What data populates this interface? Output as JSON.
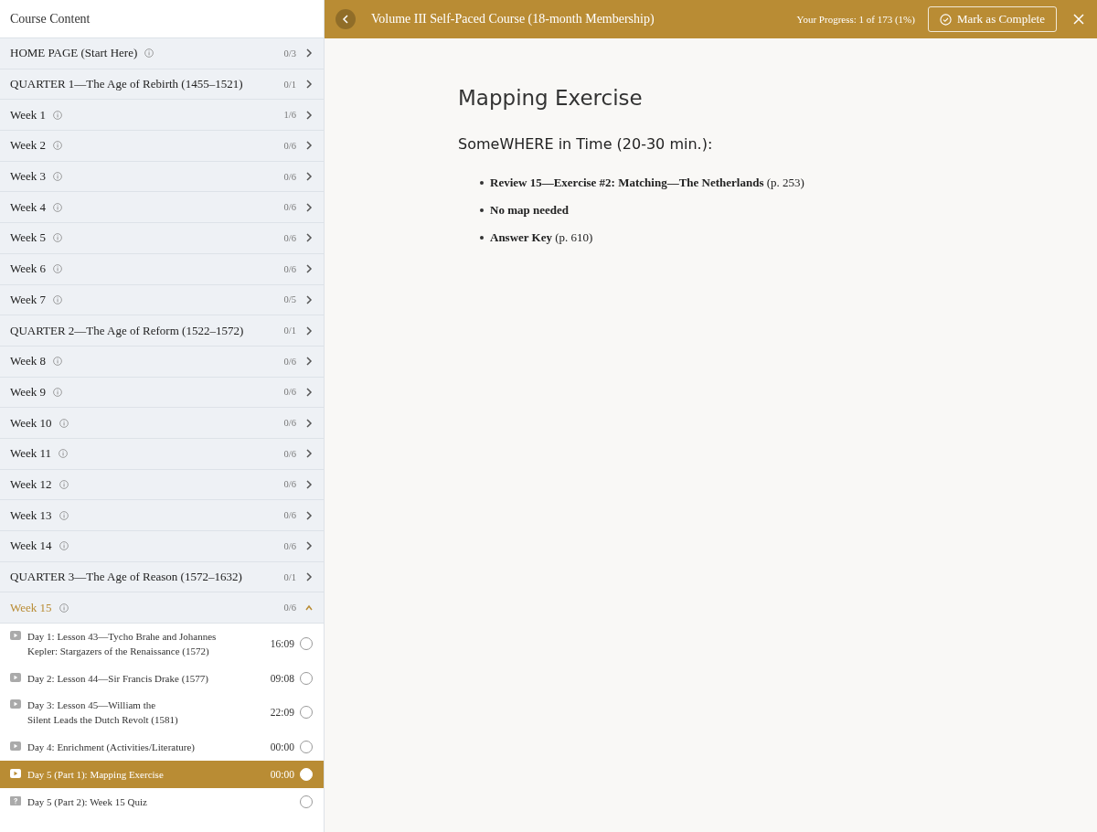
{
  "sidebar": {
    "title": "Course Content",
    "sections": [
      {
        "title": "HOME PAGE (Start Here)",
        "info": true,
        "progress": "0/3",
        "expanded": false
      },
      {
        "title": "QUARTER 1—The Age of Rebirth (1455–1521)",
        "info": false,
        "progress": "0/1",
        "expanded": false
      },
      {
        "title": "Week 1",
        "info": true,
        "progress": "1/6",
        "expanded": false
      },
      {
        "title": "Week 2",
        "info": true,
        "progress": "0/6",
        "expanded": false
      },
      {
        "title": "Week 3",
        "info": true,
        "progress": "0/6",
        "expanded": false
      },
      {
        "title": "Week 4",
        "info": true,
        "progress": "0/6",
        "expanded": false
      },
      {
        "title": "Week 5",
        "info": true,
        "progress": "0/6",
        "expanded": false
      },
      {
        "title": "Week 6",
        "info": true,
        "progress": "0/6",
        "expanded": false
      },
      {
        "title": "Week 7",
        "info": true,
        "progress": "0/5",
        "expanded": false
      },
      {
        "title": "QUARTER 2—The Age of Reform (1522–1572)",
        "info": false,
        "progress": "0/1",
        "expanded": false
      },
      {
        "title": "Week 8",
        "info": true,
        "progress": "0/6",
        "expanded": false
      },
      {
        "title": "Week 9",
        "info": true,
        "progress": "0/6",
        "expanded": false
      },
      {
        "title": "Week 10",
        "info": true,
        "progress": "0/6",
        "expanded": false
      },
      {
        "title": "Week 11",
        "info": true,
        "progress": "0/6",
        "expanded": false
      },
      {
        "title": "Week 12",
        "info": true,
        "progress": "0/6",
        "expanded": false
      },
      {
        "title": "Week 13",
        "info": true,
        "progress": "0/6",
        "expanded": false
      },
      {
        "title": "Week 14",
        "info": true,
        "progress": "0/6",
        "expanded": false
      },
      {
        "title": "QUARTER 3—The Age of Reason (1572–1632)",
        "info": false,
        "progress": "0/1",
        "expanded": false
      },
      {
        "title": "Week 15",
        "info": true,
        "progress": "0/6",
        "expanded": true,
        "lessons": [
          {
            "kind": "video",
            "lines": [
              "Day 1: Lesson 43—Tycho Brahe and Johannes",
              "Kepler: Stargazers of the Renaissance (1572)"
            ],
            "duration": "16:09",
            "selected": false,
            "checked": false
          },
          {
            "kind": "video",
            "lines": [
              "Day 2: Lesson 44—Sir Francis Drake (1577)"
            ],
            "duration": "09:08",
            "selected": false,
            "checked": false
          },
          {
            "kind": "video",
            "lines": [
              "Day 3: Lesson 45—William the",
              "Silent Leads the Dutch Revolt (1581)"
            ],
            "duration": "22:09",
            "selected": false,
            "checked": false
          },
          {
            "kind": "video",
            "lines": [
              "Day 4: Enrichment (Activities/Literature)"
            ],
            "duration": "00:00",
            "selected": false,
            "checked": false
          },
          {
            "kind": "video",
            "lines": [
              "Day 5 (Part 1): Mapping Exercise"
            ],
            "duration": "00:00",
            "selected": true,
            "checked": false
          },
          {
            "kind": "quiz",
            "lines": [
              "Day 5 (Part 2): Week 15 Quiz"
            ],
            "selected": false,
            "checked": false
          }
        ]
      }
    ]
  },
  "header": {
    "title": "Volume III Self-Paced Course (18-month Membership)",
    "progress": "Your Progress: 1 of 173 (1%)",
    "complete_button": "Mark as Complete"
  },
  "content": {
    "title": "Mapping Exercise",
    "subtitle": "SomeWHERE in Time (20-30 min.):",
    "bullets": [
      "**Review 15—Exercise #2: Matching—The Netherlands** (p. 253)",
      "**No map needed**",
      "**Answer Key** (p. 610)"
    ]
  }
}
